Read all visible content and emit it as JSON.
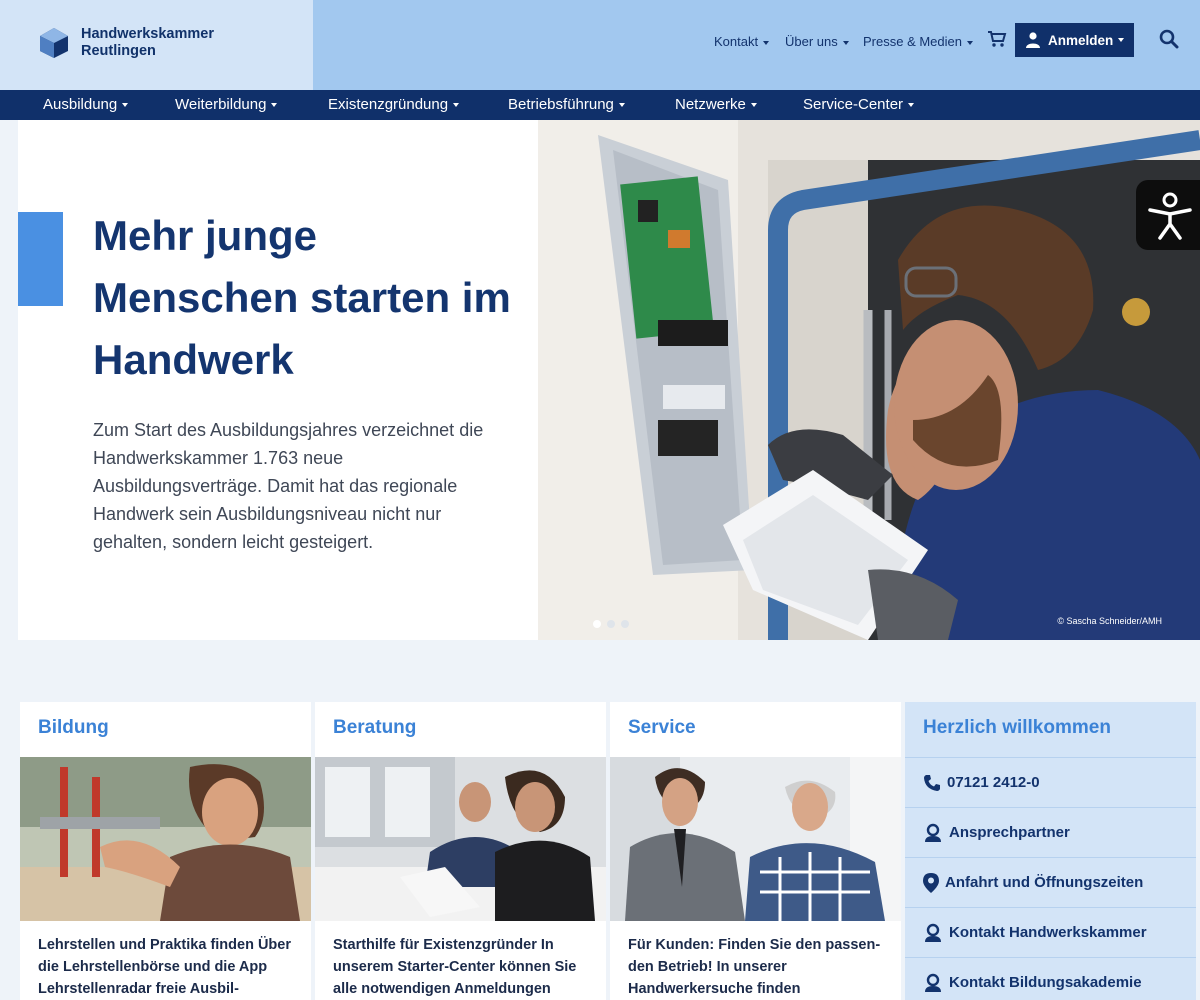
{
  "brand": {
    "line1": "Handwerkskammer",
    "line2": "Reutlingen"
  },
  "topnav": {
    "kontakt": "Kontakt",
    "ueber_uns": "Über uns",
    "presse": "Presse & Medien",
    "login": "Anmelden"
  },
  "mainnav": [
    "Ausbildung",
    "Weiterbildung",
    "Existenzgründung",
    "Betriebsführung",
    "Netzwerke",
    "Service-Center"
  ],
  "hero": {
    "title": "Mehr junge Menschen starten im Handwerk",
    "text": "Zum Start des Ausbildungsjahres verzeichnet die Handwerkskammer 1.763 neue Ausbildungsverträge. Damit hat das regionale Handwerk sein Ausbildungsniveau nicht nur gehalten, sondern leicht gesteigert.",
    "credit": "© Sascha Schneider/AMH"
  },
  "cards": [
    {
      "title": "Bildung",
      "text": "Lehrstellen und Praktika finden Über die Lehrstellenbörse und die App Lehrstellenradar freie Ausbil-"
    },
    {
      "title": "Beratung",
      "text": "Starthilfe für Existenzgründer In unserem Starter-Center können Sie alle notwendigen Anmeldungen"
    },
    {
      "title": "Service",
      "text": "Für Kunden: Finden Sie den passen-den Betrieb! In unserer Handwerkersuche finden"
    }
  ],
  "welcome": {
    "title": "Herzlich willkommen",
    "items": [
      {
        "label": "07121 2412-0",
        "icon": "phone-icon"
      },
      {
        "label": "Ansprechpartner",
        "icon": "person-icon"
      },
      {
        "label": "Anfahrt und Öffnungszeiten",
        "icon": "map-pin-icon"
      },
      {
        "label": "Kontakt Handwerkskammer",
        "icon": "person-icon"
      },
      {
        "label": "Kontakt Bildungsakademie",
        "icon": "person-icon"
      }
    ]
  },
  "colors": {
    "navy": "#10306a",
    "accent": "#4a90e2",
    "header_bg": "#a2c8ef",
    "logo_bg": "#d3e4f7"
  }
}
